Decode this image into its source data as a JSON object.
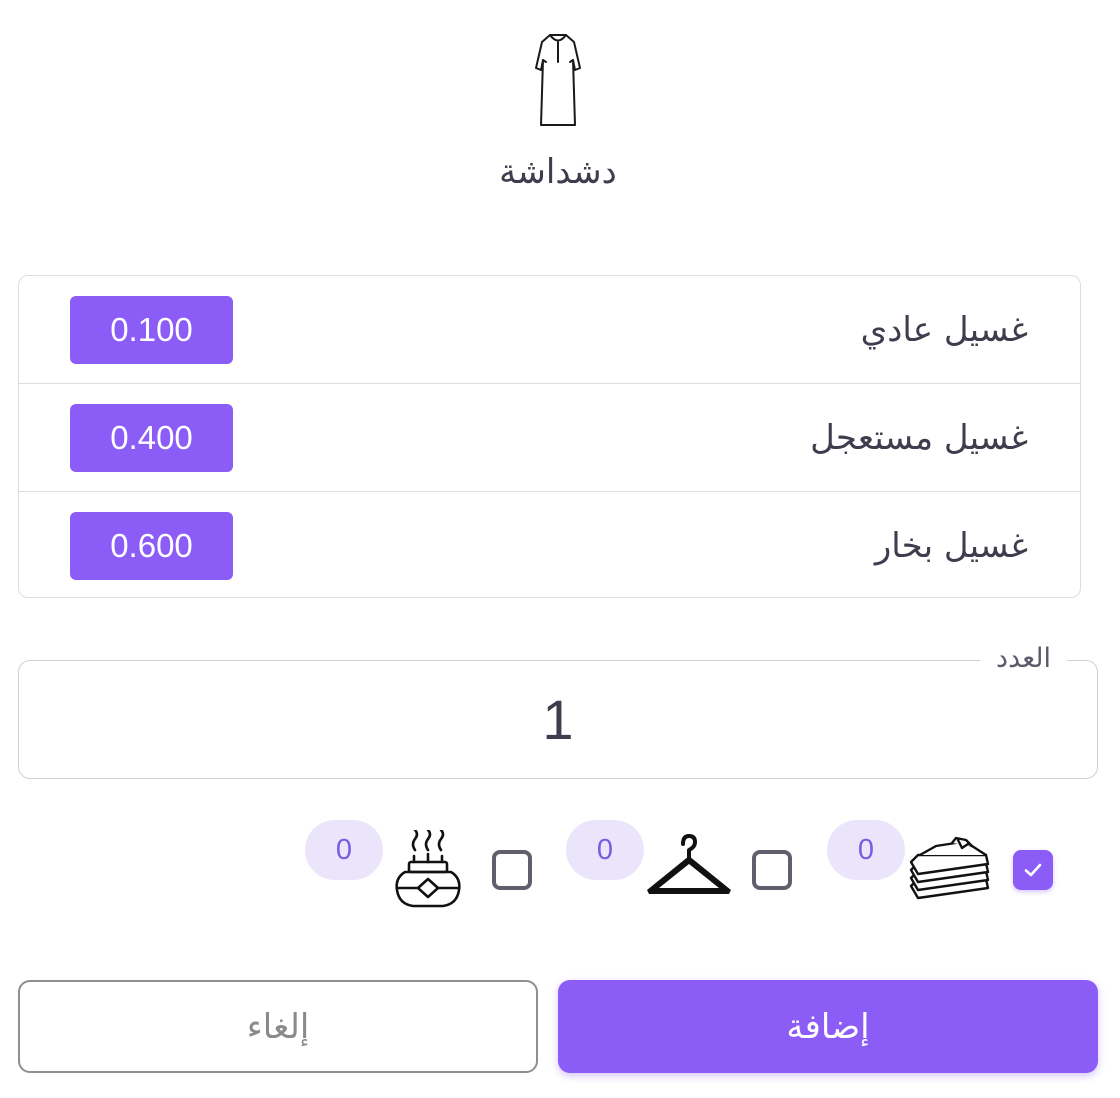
{
  "item": {
    "icon": "dishdasha-icon",
    "name": "دشداشة"
  },
  "services": [
    {
      "name": "غسيل عادي",
      "price": "0.100"
    },
    {
      "name": "غسيل مستعجل",
      "price": "0.400"
    },
    {
      "name": "غسيل بخار",
      "price": "0.600"
    }
  ],
  "quantity": {
    "label": "العدد",
    "value": "1"
  },
  "options": [
    {
      "icon": "folded-clothes-icon",
      "checked": true,
      "count": "0"
    },
    {
      "icon": "hanger-icon",
      "checked": false,
      "count": "0"
    },
    {
      "icon": "incense-burner-icon",
      "checked": false,
      "count": "0"
    }
  ],
  "actions": {
    "add_label": "إضافة",
    "cancel_label": "إلغاء"
  },
  "colors": {
    "accent": "#8b5cf6",
    "pill_bg": "#ebe5fb",
    "text": "#3d3d4e",
    "border": "#dcdde3"
  }
}
